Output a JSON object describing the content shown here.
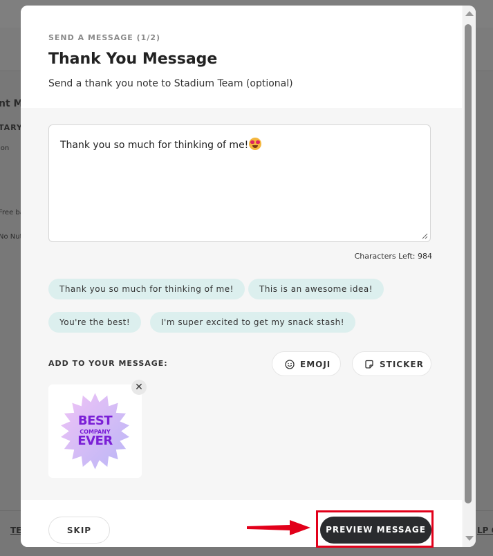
{
  "background": {
    "title_fragment": "nt Me",
    "label_fragment": "TARY",
    "line1": "ion",
    "line2": "Free ba",
    "line3": "No Nut",
    "footer_left": "TE",
    "footer_right": "LP C"
  },
  "modal": {
    "step": "SEND A MESSAGE (1/2)",
    "title": "Thank You Message",
    "subtitle": "Send a thank you note to Stadium Team (optional)",
    "message_text": "Thank you so much for thinking of me!",
    "message_emoji": "heart-eyes-emoji",
    "characters_left": "Characters Left: 984",
    "suggestions": [
      "Thank you so much for thinking of me!",
      "This is an awesome idea!",
      "You're the best!",
      "I'm super excited to get my snack stash!"
    ],
    "add_label": "ADD TO YOUR MESSAGE:",
    "emoji_button": "EMOJI",
    "sticker_button": "STICKER",
    "sticker": {
      "line1": "BEST",
      "line2": "COMPANY",
      "line3": "EVER"
    },
    "skip_button": "SKIP",
    "preview_button": "PREVIEW MESSAGE"
  },
  "colors": {
    "chip_bg": "#dcefee",
    "primary_button": "#2a2b2e",
    "highlight": "#e2001a",
    "sticker_purple": "#7a1fd6"
  }
}
